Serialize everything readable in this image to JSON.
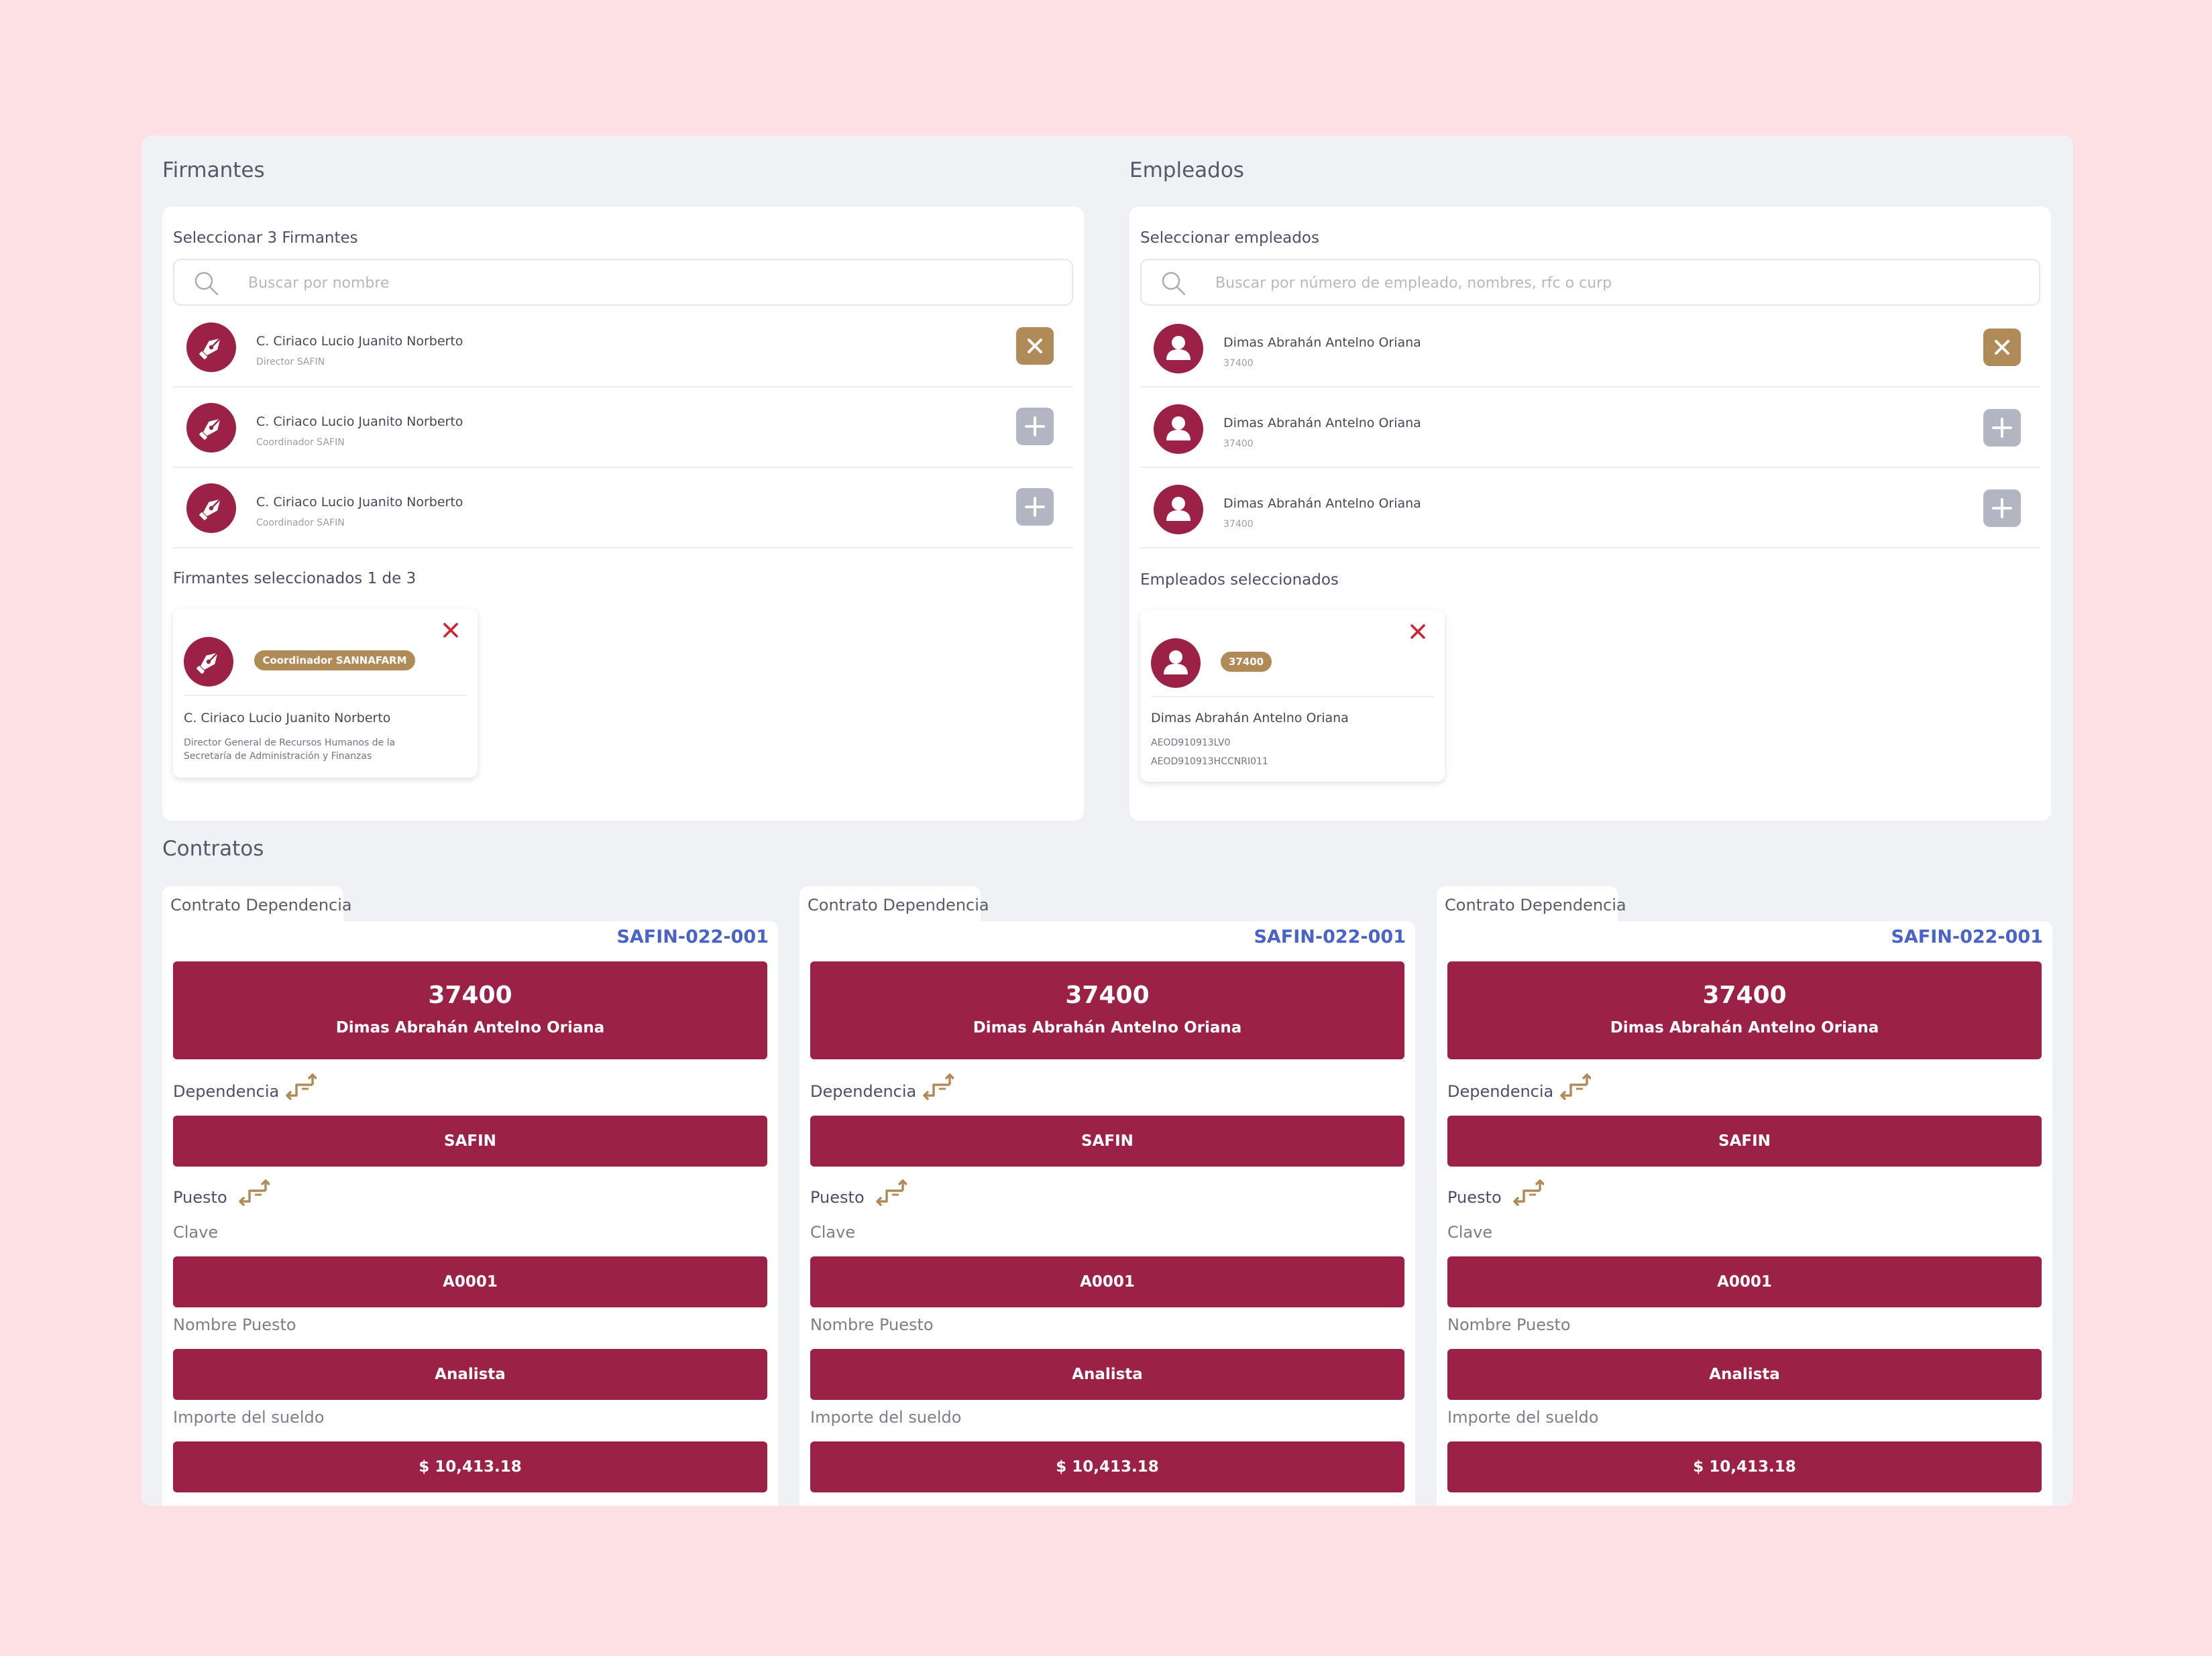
{
  "firmantes": {
    "title": "Firmantes",
    "select_label": "Seleccionar 3 Firmantes",
    "search_placeholder": "Buscar por nombre",
    "rows": [
      {
        "name": "C. Ciriaco Lucio Juanito Norberto",
        "role": "Director SAFIN",
        "action": "remove"
      },
      {
        "name": "C. Ciriaco Lucio Juanito Norberto",
        "role": "Coordinador SAFIN",
        "action": "add"
      },
      {
        "name": "C. Ciriaco Lucio Juanito Norberto",
        "role": "Coordinador SAFIN",
        "action": "add"
      }
    ],
    "selected_label": "Firmantes seleccionados 1 de 3",
    "selected": {
      "badge": "Coordinador SANNAFARM",
      "name": "C. Ciriaco Lucio Juanito Norberto",
      "desc_line1": "Director General de Recursos Humanos de la",
      "desc_line2": "Secretaría de Administración y Finanzas"
    }
  },
  "empleados": {
    "title": "Empleados",
    "select_label": "Seleccionar empleados",
    "search_placeholder": "Buscar por número de empleado, nombres, rfc o curp",
    "rows": [
      {
        "name": "Dimas Abrahán Antelno Oriana",
        "number": "37400",
        "action": "remove"
      },
      {
        "name": "Dimas Abrahán Antelno Oriana",
        "number": "37400",
        "action": "add"
      },
      {
        "name": "Dimas Abrahán Antelno Oriana",
        "number": "37400",
        "action": "add"
      }
    ],
    "selected_label": "Empleados seleccionados",
    "selected": {
      "badge": "37400",
      "name": "Dimas Abrahán Antelno Oriana",
      "rfc": "AEOD910913LV0",
      "curp": "AEOD910913HCCNRI011"
    }
  },
  "contratos": {
    "title": "Contratos",
    "items": [
      {
        "tab": "Contrato Dependencia",
        "code": "SAFIN-022-001",
        "number": "37400",
        "name": "Dimas Abrahán Antelno Oriana",
        "dependencia_label": "Dependencia",
        "dependencia": "SAFIN",
        "puesto_label": "Puesto",
        "clave_label": "Clave",
        "clave": "A0001",
        "nombre_puesto_label": "Nombre Puesto",
        "nombre_puesto": "Analista",
        "importe_label": "Importe del sueldo",
        "importe": "$ 10,413.18"
      },
      {
        "tab": "Contrato Dependencia",
        "code": "SAFIN-022-001",
        "number": "37400",
        "name": "Dimas Abrahán Antelno Oriana",
        "dependencia_label": "Dependencia",
        "dependencia": "SAFIN",
        "puesto_label": "Puesto",
        "clave_label": "Clave",
        "clave": "A0001",
        "nombre_puesto_label": "Nombre Puesto",
        "nombre_puesto": "Analista",
        "importe_label": "Importe del sueldo",
        "importe": "$ 10,413.18"
      },
      {
        "tab": "Contrato Dependencia",
        "code": "SAFIN-022-001",
        "number": "37400",
        "name": "Dimas Abrahán Antelno Oriana",
        "dependencia_label": "Dependencia",
        "dependencia": "SAFIN",
        "puesto_label": "Puesto",
        "clave_label": "Clave",
        "clave": "A0001",
        "nombre_puesto_label": "Nombre Puesto",
        "nombre_puesto": "Analista",
        "importe_label": "Importe del sueldo",
        "importe": "$ 10,413.18"
      }
    ]
  },
  "colors": {
    "background": "#fde0e4",
    "panel": "#f0f1f5",
    "primary": "#9c2146",
    "gold": "#b08b57",
    "link_blue": "#4a63c8",
    "remove_red": "#d32030"
  },
  "icons": {
    "search": "search-icon",
    "signer": "pen-nib-icon",
    "employee": "user-icon",
    "remove": "close-icon",
    "add": "plus-icon",
    "swap": "swap-arrows-icon"
  }
}
